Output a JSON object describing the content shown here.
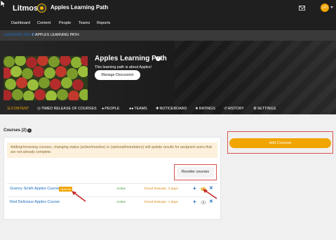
{
  "header": {
    "brand": "Litmos",
    "app_title": "Apples Learning Path",
    "avatar_initials": "LPI",
    "icons": {
      "mail": "mail-icon",
      "logo": "litmos-logo-icon"
    }
  },
  "nav": {
    "items": [
      {
        "label": "Dashboard"
      },
      {
        "label": "Content"
      },
      {
        "label": "People"
      },
      {
        "label": "Teams"
      },
      {
        "label": "Reports"
      }
    ]
  },
  "breadcrumb": {
    "link": "LEARNING PATHS",
    "separator": "/",
    "current": "APPLES LEARNING PATH"
  },
  "hero": {
    "title": "Apples Learning Path",
    "description": "This learning path is about Apples!",
    "manage_button": "Manage Discussion"
  },
  "tabs": [
    {
      "label": "CONTENT",
      "icon": "list-icon",
      "active": true
    },
    {
      "label": "TIMED RELEASE OF COURSES",
      "icon": "clock-icon",
      "active": false
    },
    {
      "label": "PEOPLE",
      "icon": "person-icon",
      "active": false
    },
    {
      "label": "TEAMS",
      "icon": "team-icon",
      "active": false
    },
    {
      "label": "NOTICEBOARD",
      "icon": "noticeboard-icon",
      "active": false
    },
    {
      "label": "RATINGS",
      "icon": "star-icon",
      "active": false
    },
    {
      "label": "HISTORY",
      "icon": "history-icon",
      "active": false
    },
    {
      "label": "SETTINGS",
      "icon": "gear-icon",
      "active": false
    }
  ],
  "courses": {
    "heading": "Courses (2)",
    "warning": "Adding/removing courses, changing status (active/inactive) or (optional/mandatory) will update results for assigned users that are not already complete.",
    "reorder_button": "Reorder courses",
    "add_button": "Add Courses",
    "rows": [
      {
        "name": "Granny Smith Apples Course",
        "badge": "Optional",
        "status": "Active",
        "timed": "Timed Release: 0 days"
      },
      {
        "name": "Red Delicious Apples Course",
        "badge": "",
        "status": "Active",
        "timed": "Timed Release: 1 days"
      }
    ]
  },
  "colors": {
    "accent": "#f0a500",
    "link": "#1e6cc0",
    "highlight_outline": "#d9534f",
    "active_status": "#3a9a3a"
  }
}
